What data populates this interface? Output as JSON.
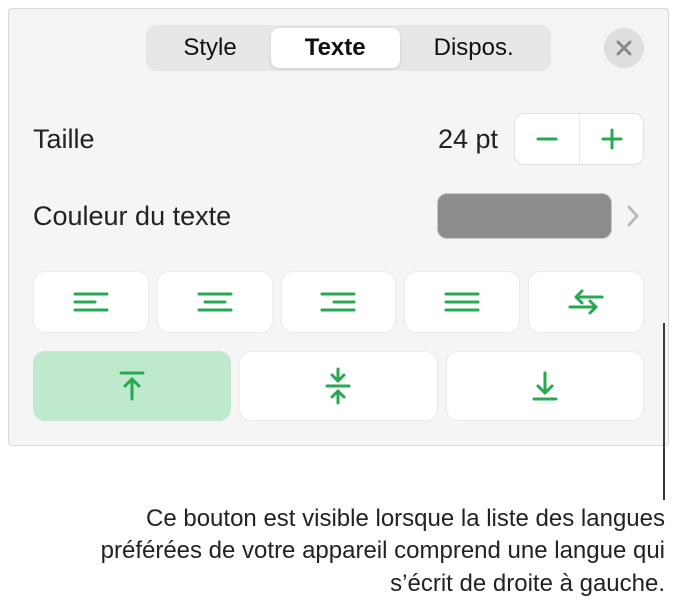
{
  "tabs": {
    "items": [
      {
        "label": "Style",
        "active": false
      },
      {
        "label": "Texte",
        "active": true
      },
      {
        "label": "Dispos.",
        "active": false
      }
    ]
  },
  "size": {
    "label": "Taille",
    "value": "24 pt"
  },
  "textColor": {
    "label": "Couleur du texte",
    "swatch": "#8c8c8c"
  },
  "accent": "#27a952",
  "align": {
    "left": "align-left",
    "center": "align-center",
    "right": "align-right",
    "justify": "align-justify",
    "rtl": "text-direction-rtl"
  },
  "valign": {
    "top": "valign-top",
    "middle": "valign-middle",
    "bottom": "valign-bottom",
    "selected": "top"
  },
  "caption": "Ce bouton est visible lorsque la liste des langues préférées de votre appareil comprend une langue qui s’écrit de droite à gauche."
}
